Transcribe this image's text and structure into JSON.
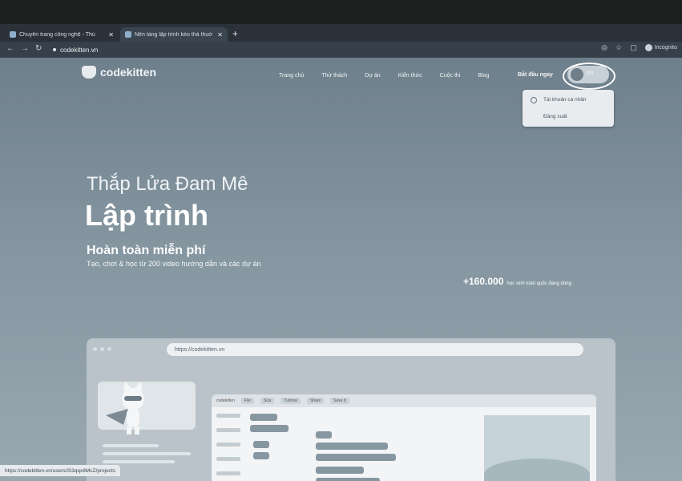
{
  "browser": {
    "tabs": [
      {
        "label": "Chuyên trang công nghệ - Thủ"
      },
      {
        "label": "Nền tảng lập trình kéo thả thuở"
      }
    ],
    "new_tab": "+",
    "url": "codekitten.vn",
    "profile": "Incognito"
  },
  "site": {
    "logo": "codekitten",
    "nav": [
      "Trang chủ",
      "Thử thách",
      "Dự án",
      "Kiến thức",
      "Cuộc thi",
      "Blog"
    ],
    "cta": "Bắt đầu ngay",
    "user_short": "Kitt",
    "menu": [
      "Tài khoản cá nhân",
      "Đăng xuất"
    ]
  },
  "hero": {
    "line1": "Thắp Lửa Đam Mê",
    "line2": "Lập trình",
    "line3": "Hoàn toàn miễn phí",
    "line4": "Tạo, chơi & học từ 200 video hướng dẫn và các dự án",
    "stat_number": "+160.000",
    "stat_caption": "học sinh toàn quốc đang dùng"
  },
  "preview": {
    "url": "https://codekitten.vn",
    "editor_label": "codekitten",
    "editor_buttons": [
      "File",
      "Sửa",
      "Tutorial",
      "Share",
      "Save It"
    ]
  },
  "status_url": "https://codekitten.vn/users/iS3qqx8McZ/projects"
}
